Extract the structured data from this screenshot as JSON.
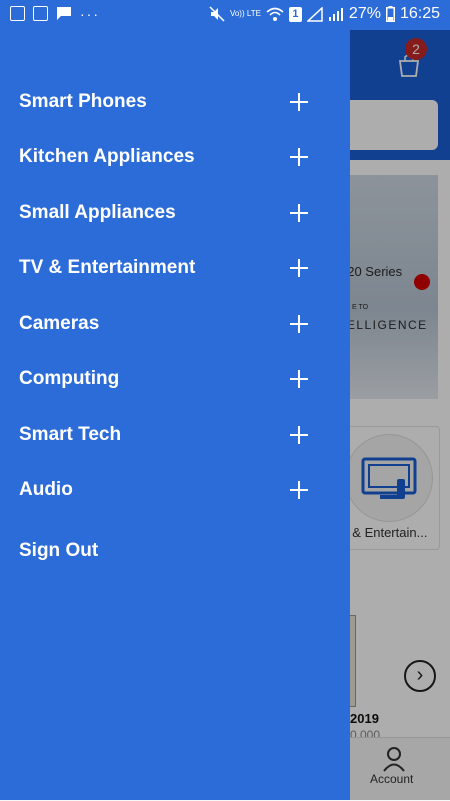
{
  "status_bar": {
    "battery": "27%",
    "time": "16:25",
    "volte": "Vo)) LTE",
    "sim_badge": "1",
    "overflow": "···",
    "icons": [
      "image-icon",
      "grid-app-icon",
      "message-icon",
      "mute-icon",
      "wifi-icon",
      "signal-icon",
      "battery-icon"
    ]
  },
  "drawer": {
    "items": [
      {
        "label": "Smart Phones"
      },
      {
        "label": "Kitchen Appliances"
      },
      {
        "label": "Small Appliances"
      },
      {
        "label": "TV & Entertainment"
      },
      {
        "label": "Cameras"
      },
      {
        "label": "Computing"
      },
      {
        "label": "Smart Tech"
      },
      {
        "label": "Audio"
      }
    ],
    "sign_out_label": "Sign Out",
    "expand_icon": "plus-icon"
  },
  "background": {
    "cart_count": "2",
    "banner_line1": "e20 Series",
    "banner_line2": "TELLIGENCE",
    "banner_line3": "E TO",
    "category_label": "V & Entertain...",
    "product_title": "2019",
    "product_price": "0 000",
    "nav_account_label": "Account"
  },
  "colors": {
    "drawer_bg": "#2c6cd8",
    "header_bg": "#1a5fd6",
    "badge": "#c62828"
  }
}
